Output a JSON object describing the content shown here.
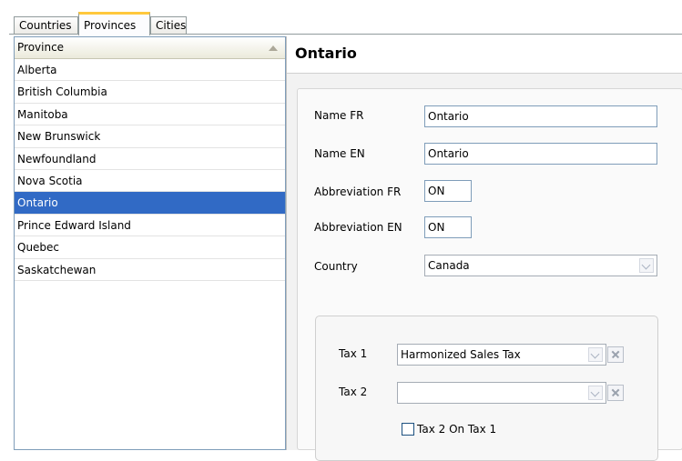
{
  "tabs": [
    {
      "label": "Countries",
      "active": false
    },
    {
      "label": "Provinces",
      "active": true
    },
    {
      "label": "Cities",
      "active": false
    }
  ],
  "list": {
    "column_header": "Province",
    "sort": "ascending",
    "items": [
      "Alberta",
      "British Columbia",
      "Manitoba",
      "New Brunswick",
      "Newfoundland",
      "Nova Scotia",
      "Ontario",
      "Prince Edward Island",
      "Quebec",
      "Saskatchewan"
    ],
    "selected": "Ontario"
  },
  "detail": {
    "title": "Ontario",
    "fields": {
      "name_fr": {
        "label": "Name FR",
        "value": "Ontario"
      },
      "name_en": {
        "label": "Name EN",
        "value": "Ontario"
      },
      "abbr_fr": {
        "label": "Abbreviation FR",
        "value": "ON"
      },
      "abbr_en": {
        "label": "Abbreviation EN",
        "value": "ON"
      },
      "country": {
        "label": "Country",
        "value": "Canada"
      }
    },
    "tax": {
      "tax1": {
        "label": "Tax 1",
        "value": "Harmonized Sales Tax"
      },
      "tax2": {
        "label": "Tax 2",
        "value": ""
      },
      "tax2_on_tax1": {
        "label": "Tax 2 On Tax 1",
        "checked": false
      }
    }
  },
  "colors": {
    "selection": "#316ac5",
    "active_tab_accent": "#ffc83c",
    "border": "#7f9db9"
  }
}
